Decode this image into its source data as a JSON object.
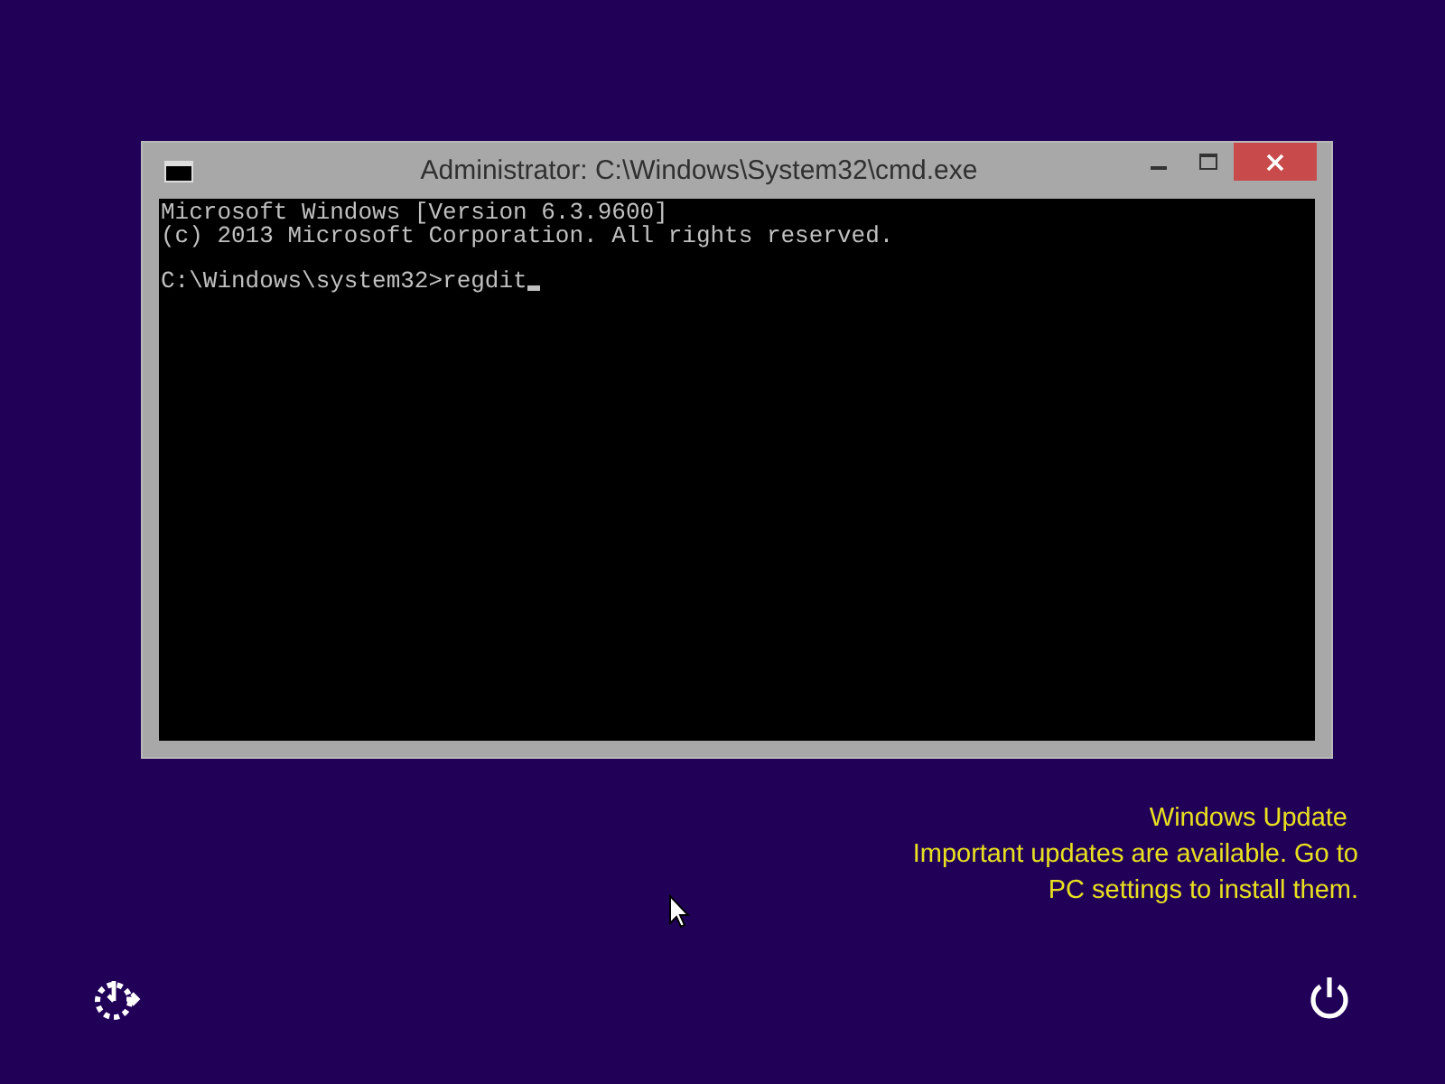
{
  "console_window": {
    "title": "Administrator: C:\\Windows\\System32\\cmd.exe",
    "banner_lines": [
      "Microsoft Windows [Version 6.3.9600]",
      "(c) 2013 Microsoft Corporation. All rights reserved."
    ],
    "prompt": "C:\\Windows\\system32>regdit"
  },
  "notification": {
    "title": "Windows Update",
    "message_lines": [
      "Important updates are available. Go to",
      "PC settings to install them."
    ]
  }
}
